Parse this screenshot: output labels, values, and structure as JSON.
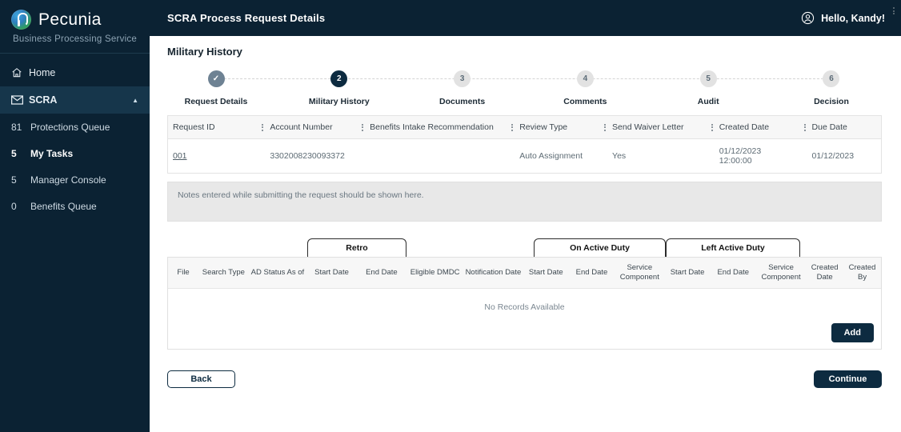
{
  "brand": {
    "name": "Pecunia",
    "tagline": "Business Processing Service",
    "logo_icon": "globe-p-logo-icon"
  },
  "sidebar": {
    "items": [
      {
        "label": "Home",
        "icon": "home-icon",
        "count": ""
      },
      {
        "label": "SCRA",
        "icon": "envelope-icon",
        "count": "",
        "caret": "chevron-up-icon"
      }
    ],
    "sub_items": [
      {
        "count": "81",
        "label": "Protections Queue"
      },
      {
        "count": "5",
        "label": "My Tasks"
      },
      {
        "count": "5",
        "label": "Manager Console"
      },
      {
        "count": "0",
        "label": "Benefits Queue"
      }
    ]
  },
  "topbar": {
    "title": "SCRA Process Request Details",
    "user_greeting": "Hello, Kandy!",
    "user_icon": "user-circle-icon"
  },
  "page": {
    "title": "Military History"
  },
  "stepper": {
    "steps": [
      {
        "num": "✓",
        "label": "Request Details",
        "state": "done"
      },
      {
        "num": "2",
        "label": "Military History",
        "state": "current"
      },
      {
        "num": "3",
        "label": "Documents",
        "state": "upcoming"
      },
      {
        "num": "4",
        "label": "Comments",
        "state": "upcoming"
      },
      {
        "num": "5",
        "label": "Audit",
        "state": "upcoming"
      },
      {
        "num": "6",
        "label": "Decision",
        "state": "upcoming"
      }
    ]
  },
  "request_table": {
    "columns": [
      "Request ID",
      "Account Number",
      "Benefits Intake Recommendation",
      "Review Type",
      "Send Waiver Letter",
      "Created Date",
      "Due Date"
    ],
    "rows": [
      {
        "request_id": "001",
        "account_number": "3302008230093372",
        "benefits_intake_recommendation": "",
        "review_type": "Auto Assignment",
        "send_waiver_letter": "Yes",
        "created_date": "01/12/2023 12:00:00",
        "due_date": "01/12/2023"
      }
    ]
  },
  "notes": {
    "text": "Notes entered while submitting the request should be shown here."
  },
  "tabs": [
    {
      "label": "Retro"
    },
    {
      "label": "On Active Duty"
    },
    {
      "label": "Left Active Duty"
    }
  ],
  "history_table": {
    "columns": [
      "File",
      "Search Type",
      "AD Status As of",
      "Start Date",
      "End Date",
      "Eligible DMDC",
      "Notification Date",
      "Start Date",
      "End Date",
      "Service Component",
      "Start Date",
      "End Date",
      "Service Component",
      "Created Date",
      "Created By"
    ],
    "empty_message": "No Records Available",
    "add_label": "Add"
  },
  "footer": {
    "back_label": "Back",
    "continue_label": "Continue"
  },
  "colors": {
    "navy": "#0b2233",
    "navy_btn": "#0d2b40",
    "step_done": "#6e8293",
    "step_upcoming": "#e2e2e2",
    "notes_bg": "#e8e8e8"
  }
}
